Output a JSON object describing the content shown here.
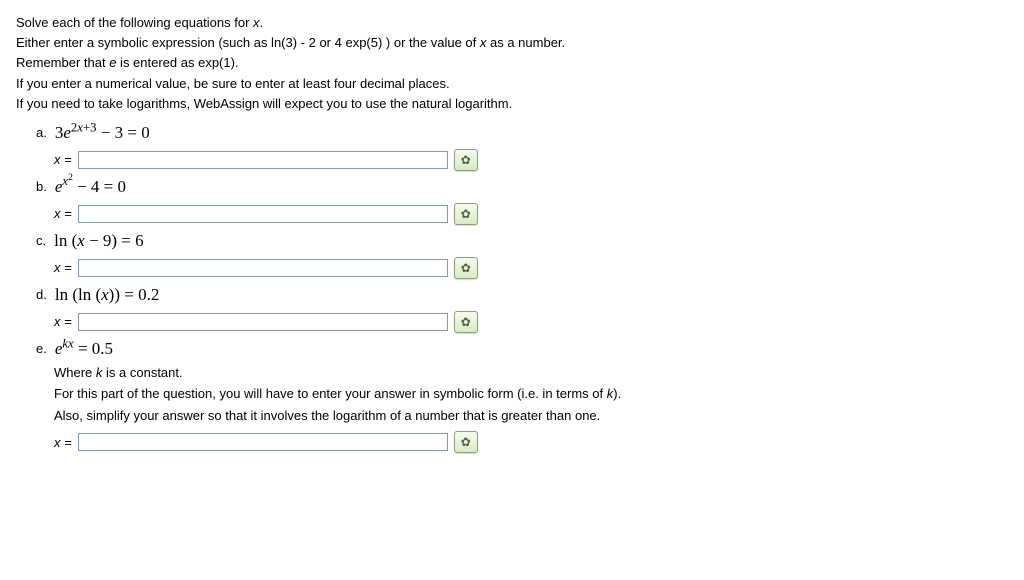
{
  "instructions": {
    "line1_a": "Solve each of the following equations for ",
    "line1_b": ".",
    "line2_a": "Either enter a symbolic expression (such as ln(3) - 2 or 4 exp(5) ) or the value of ",
    "line2_b": " as a number.",
    "line3_a": "Remember that ",
    "line3_b": " is entered as exp(1).",
    "line4": "If you enter a numerical value, be sure to enter at least four decimal places.",
    "line5": "If you need to take logarithms, WebAssign will expect you to use the natural logarithm."
  },
  "labels": {
    "x_eq": "x =",
    "x": "x",
    "e": "e",
    "a": "a.",
    "b": "b.",
    "c": "c.",
    "d": "d.",
    "e_label": "e."
  },
  "equations": {
    "a": "3e^{2x+3} − 3 = 0",
    "b": "e^{x^2} − 4 = 0",
    "c": "ln (x − 9) = 6",
    "d": "ln (ln (x)) = 0.2",
    "e": "e^{kx} = 0.5"
  },
  "part_e_notes": {
    "where": "Where ",
    "where2": " is a constant.",
    "k": "k",
    "note1_a": "For this part of the question, you will have to enter your answer in symbolic form (i.e. in terms of ",
    "note1_b": ").",
    "note2": "Also, simplify your answer so that it involves the logarithm of a number that is greater than one."
  },
  "icons": {
    "hint": "✿"
  }
}
